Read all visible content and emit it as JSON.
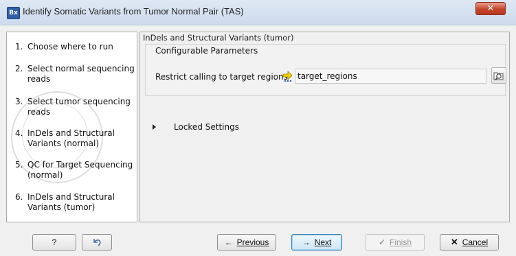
{
  "window": {
    "title": "Identify Somatic Variants from Tumor Normal Pair (TAS)",
    "app_icon_text": "Bx",
    "close_glyph": "✕"
  },
  "steps": [
    {
      "num": "1.",
      "label": "Choose where to run"
    },
    {
      "num": "2.",
      "label": "Select normal sequencing reads"
    },
    {
      "num": "3.",
      "label": "Select tumor sequencing reads"
    },
    {
      "num": "4.",
      "label": "InDels and Structural Variants (normal)"
    },
    {
      "num": "5.",
      "label": "QC for Target Sequencing (normal)"
    },
    {
      "num": "6.",
      "label": "InDels and Structural Variants (tumor)"
    }
  ],
  "content": {
    "section_title": "InDels and Structural Variants (tumor)",
    "group_title": "Configurable Parameters",
    "param_label": "Restrict calling to target regions",
    "param_value": "target_regions",
    "locked_label": "Locked Settings"
  },
  "buttons": {
    "help": "?",
    "reset_icon": "reset-icon",
    "previous": "Previous",
    "next": "Next",
    "finish": "Finish",
    "cancel": "Cancel"
  },
  "colors": {
    "title_bar": "#cddbee",
    "close_button": "#c5432a",
    "primary_button_border": "#3c7fb1"
  }
}
